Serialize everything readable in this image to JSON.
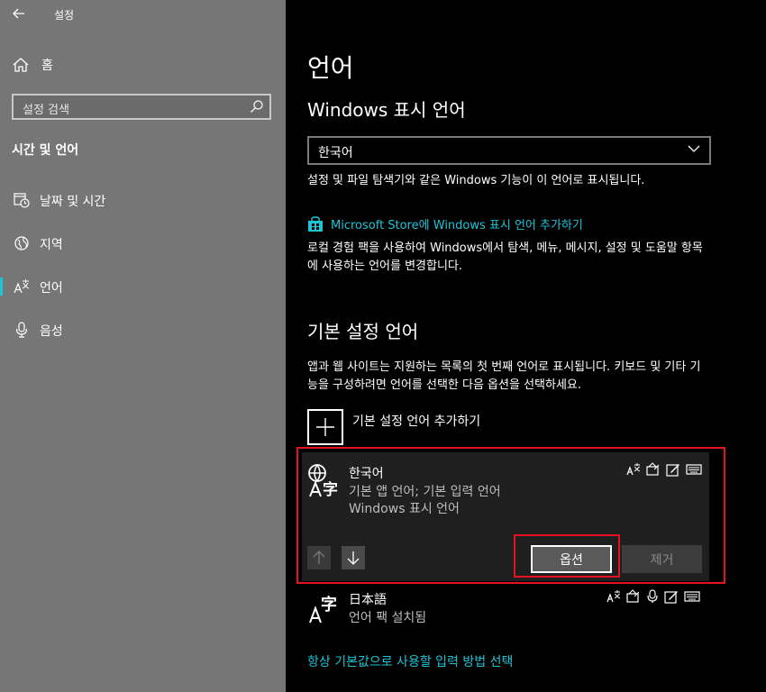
{
  "app": {
    "title": "설정"
  },
  "sidebar": {
    "home_label": "홈",
    "search_placeholder": "설정 검색",
    "section_title": "시간 및 언어",
    "items": [
      {
        "label": "날짜 및 시간",
        "icon": "calendar-clock-icon"
      },
      {
        "label": "지역",
        "icon": "globe-region-icon"
      },
      {
        "label": "언어",
        "icon": "language-icon",
        "active": true
      },
      {
        "label": "음성",
        "icon": "microphone-icon"
      }
    ]
  },
  "main": {
    "page_title": "언어",
    "display_language": {
      "heading": "Windows 표시 언어",
      "selected": "한국어",
      "description": "설정 및 파일 탐색기와 같은 Windows 기능이 이 언어로 표시됩니다.",
      "store_link": "Microsoft Store에 Windows 표시 언어 추가하기",
      "store_desc": "로컬 경험 팩을 사용하여 Windows에서 탐색, 메뉴, 메시지, 설정 및 도움말 항목에 사용하는 언어를 변경합니다."
    },
    "preferred": {
      "heading": "기본 설정 언어",
      "description": "앱과 웹 사이트는 지원하는 목록의 첫 번째 언어로 표시됩니다. 키보드 및 기타 기능을 구성하려면 언어를 선택한 다음 옵션을 선택하세요.",
      "add_label": "기본 설정 언어 추가하기",
      "languages": [
        {
          "name": "한국어",
          "line1": "기본 앱 언어; 기본 입력 언어",
          "line2": "Windows 표시 언어"
        },
        {
          "name": "日本語",
          "line1": "언어 팩 설치됨"
        }
      ],
      "options_label": "옵션",
      "remove_label": "제거"
    },
    "bottom_link": "항상 기본값으로 사용할 입력 방법 선택"
  },
  "colors": {
    "accent": "#1ec4d6",
    "highlight": "#e81123",
    "sidebar_bg": "#767676"
  }
}
